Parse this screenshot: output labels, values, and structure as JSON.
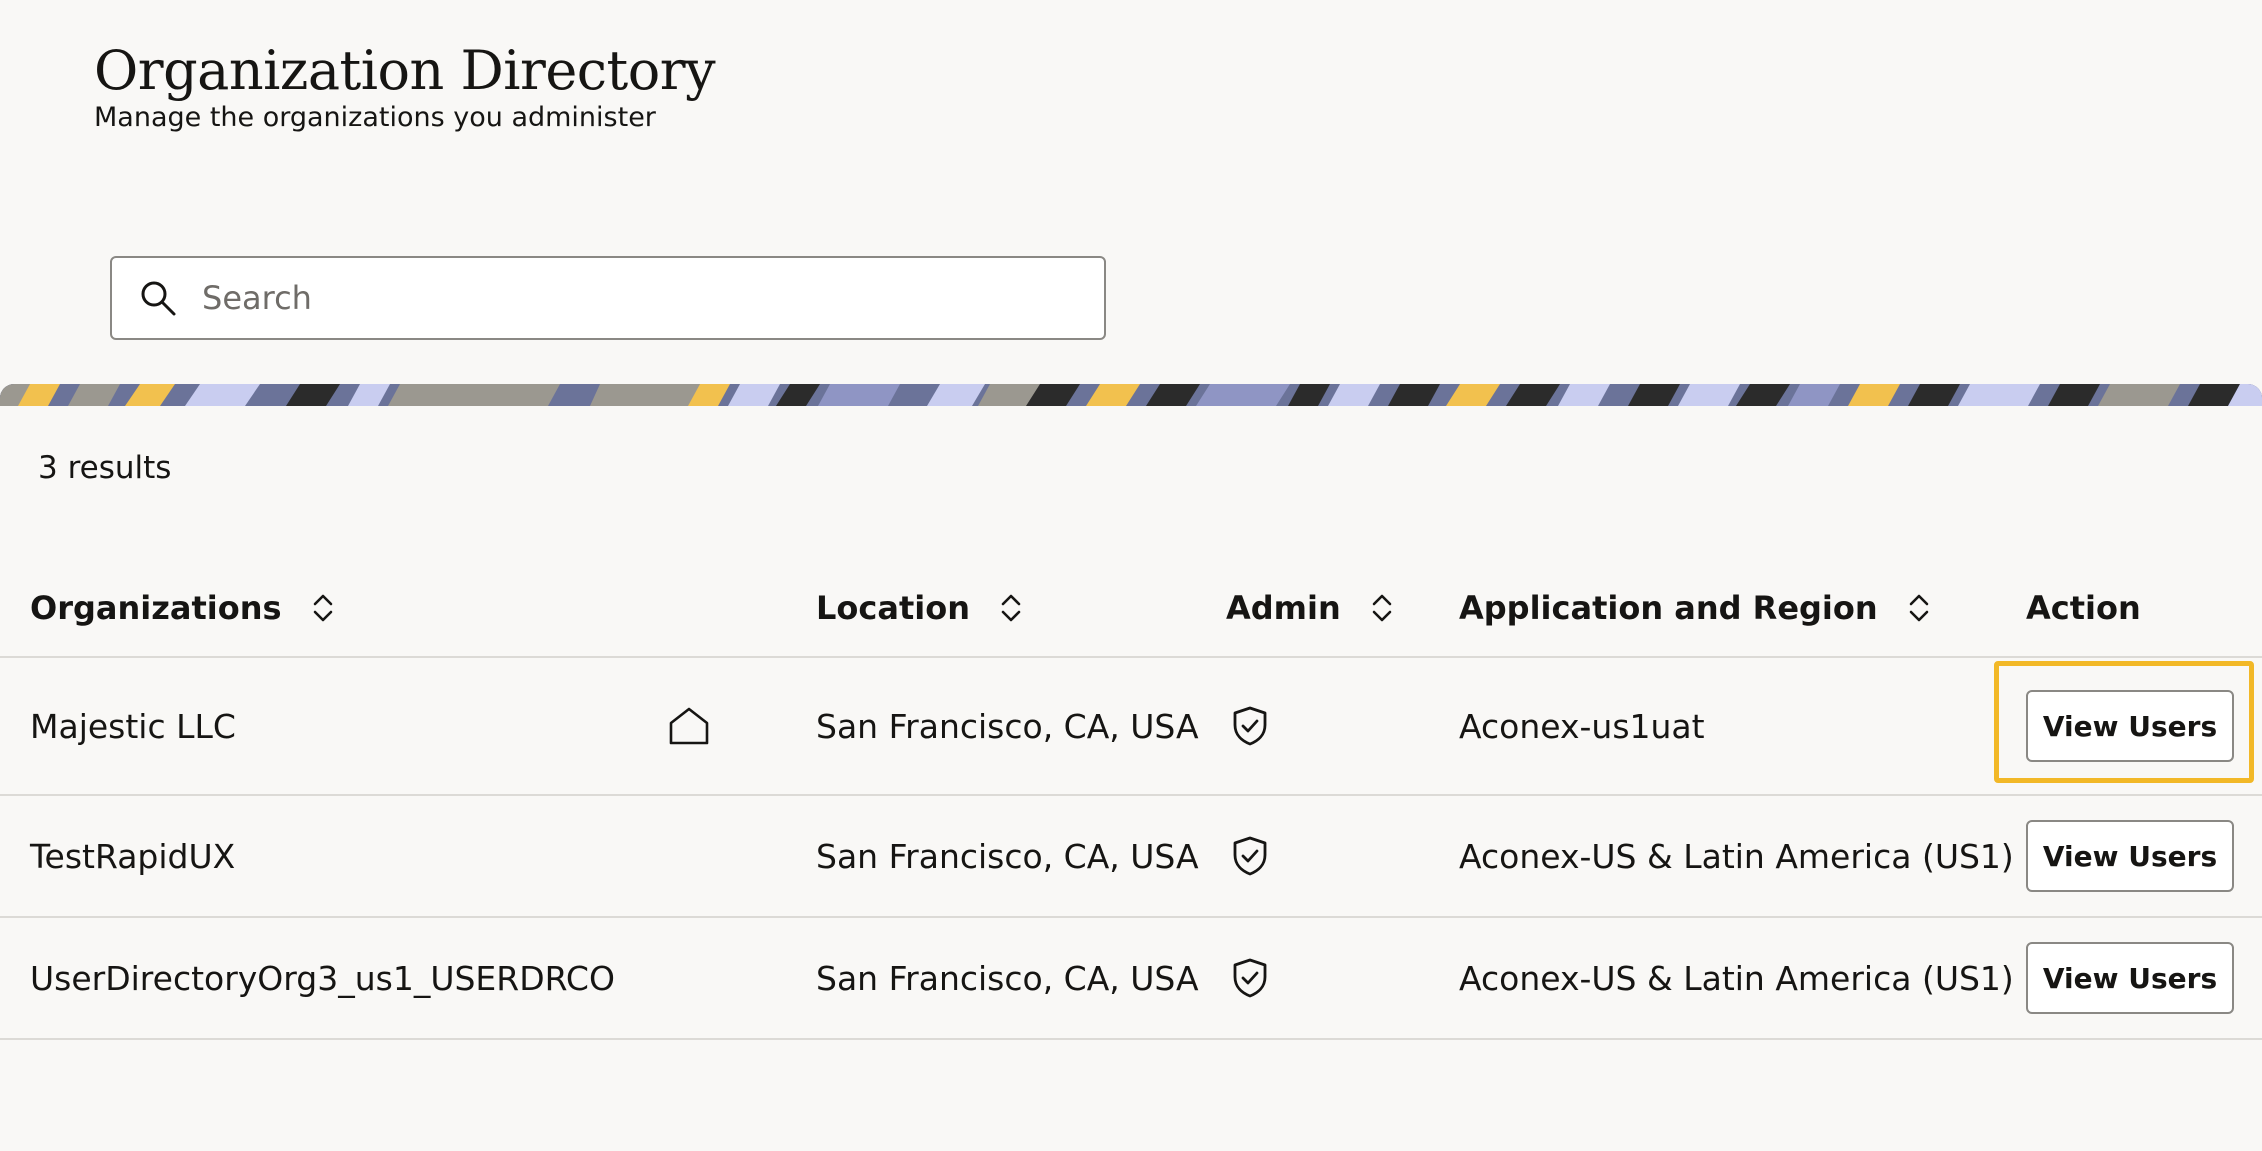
{
  "header": {
    "title": "Organization Directory",
    "subtitle": "Manage the organizations you administer"
  },
  "search": {
    "placeholder": "Search",
    "value": "",
    "icon": "search-icon"
  },
  "banner": {
    "colors": [
      "#6b7399",
      "#c9cdf0",
      "#f2c14e",
      "#2b2b2b",
      "#9b9890",
      "#8f95c4"
    ]
  },
  "results": {
    "count_label": "3 results"
  },
  "table": {
    "columns": [
      {
        "label": "Organizations",
        "sortable": true
      },
      {
        "label": "Location",
        "sortable": true
      },
      {
        "label": "Admin",
        "sortable": true
      },
      {
        "label": "Application and Region",
        "sortable": true
      },
      {
        "label": "Action",
        "sortable": false
      }
    ],
    "rows": [
      {
        "organization": "Majestic LLC",
        "home_org": true,
        "location": "San Francisco, CA, USA",
        "admin": true,
        "application_region": "Aconex-us1uat",
        "action_label": "View Users",
        "highlighted": true
      },
      {
        "organization": "TestRapidUX",
        "home_org": false,
        "location": "San Francisco, CA, USA",
        "admin": true,
        "application_region": "Aconex-US & Latin America (US1)",
        "action_label": "View Users",
        "highlighted": false
      },
      {
        "organization": "UserDirectoryOrg3_us1_USERDRCO",
        "home_org": false,
        "location": "San Francisco, CA, USA",
        "admin": true,
        "application_region": "Aconex-US & Latin America (US1)",
        "action_label": "View Users",
        "highlighted": false
      }
    ]
  },
  "colors": {
    "background": "#f9f8f6",
    "text": "#161513",
    "border": "#8a8884",
    "divider": "#dcdad6",
    "highlight": "#f2b827"
  }
}
